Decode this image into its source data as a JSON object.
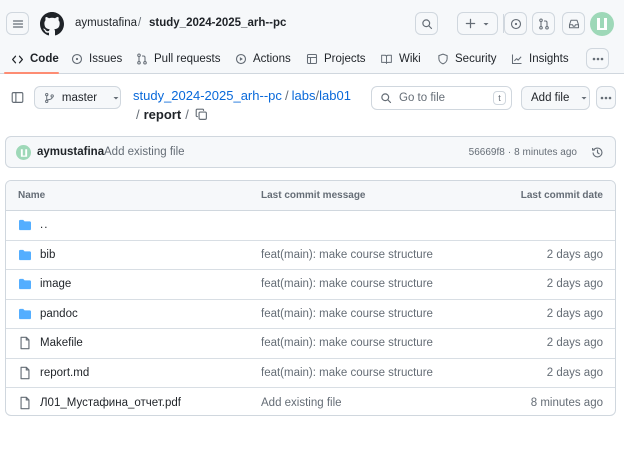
{
  "header": {
    "owner": "aymustafina",
    "separator": "/",
    "repo": "study_2024-2025_arh--pc"
  },
  "repo_tabs": [
    {
      "label": "Code",
      "icon": "code-icon"
    },
    {
      "label": "Issues",
      "icon": "issue-icon"
    },
    {
      "label": "Pull requests",
      "icon": "pull-request-icon"
    },
    {
      "label": "Actions",
      "icon": "play-icon"
    },
    {
      "label": "Projects",
      "icon": "table-icon"
    },
    {
      "label": "Wiki",
      "icon": "book-icon"
    },
    {
      "label": "Security",
      "icon": "shield-icon"
    },
    {
      "label": "Insights",
      "icon": "graph-icon"
    }
  ],
  "file_nav": {
    "branch": "master",
    "path_repo": "study_2024-2025_arh--pc",
    "path_seg1": "labs",
    "path_seg2": "lab01",
    "path_current": "report",
    "sep": "/",
    "goto_placeholder": "Go to file",
    "goto_shortcut": "t",
    "add_file": "Add file"
  },
  "latest_commit": {
    "author": "aymustafina",
    "message": "Add existing file",
    "hash": "56669f8",
    "dot": "·",
    "time": "8 minutes ago"
  },
  "files_table": {
    "headers": {
      "name": "Name",
      "message": "Last commit message",
      "date": "Last commit date"
    },
    "parent": "..",
    "rows": [
      {
        "name": "bib",
        "type": "folder",
        "message": "feat(main): make course structure",
        "date": "2 days ago"
      },
      {
        "name": "image",
        "type": "folder",
        "message": "feat(main): make course structure",
        "date": "2 days ago"
      },
      {
        "name": "pandoc",
        "type": "folder",
        "message": "feat(main): make course structure",
        "date": "2 days ago"
      },
      {
        "name": "Makefile",
        "type": "file",
        "message": "feat(main): make course structure",
        "date": "2 days ago"
      },
      {
        "name": "report.md",
        "type": "file",
        "message": "feat(main): make course structure",
        "date": "2 days ago"
      },
      {
        "name": "Л01_Мустафина_отчет.pdf",
        "type": "file",
        "message": "Add existing file",
        "date": "8 minutes ago"
      }
    ]
  },
  "colors": {
    "accent": "#0969da",
    "folder": "#54aeff",
    "tab_underline": "#fd8c73",
    "avatar": "#9ed8b8"
  }
}
